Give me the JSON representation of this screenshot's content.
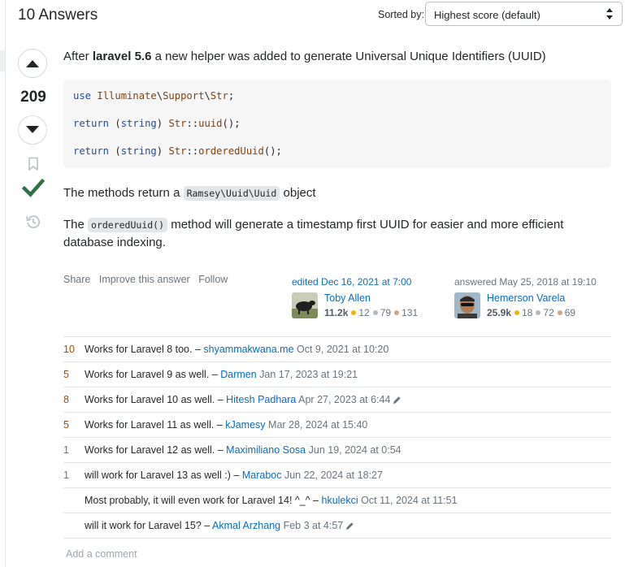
{
  "header": {
    "answers_count": "10 Answers",
    "sort_label": "Sorted by:",
    "sort_value": "Highest score (default)"
  },
  "voting": {
    "score": "209",
    "upvote_icon": "upvote-icon",
    "downvote_icon": "downvote-icon",
    "bookmark_icon": "bookmark-icon",
    "accepted_icon": "checkmark-icon",
    "history_icon": "history-icon",
    "accepted_color": "#2f6f44"
  },
  "post": {
    "intro_before": "After ",
    "intro_bold": "laravel 5.6",
    "intro_after": " a new helper was added to generate Universal Unique Identifiers (UUID)",
    "code": {
      "l1_kw": "use",
      "l1_ns1": "Illuminate",
      "l1_sep": "\\",
      "l1_ns2": "Support",
      "l1_ns3": "Str",
      "l1_end": ";",
      "l2_kw": "return",
      "l2_paren_open": "(",
      "l2_type": "string",
      "l2_paren_close": ")",
      "l2_cls": "Str",
      "l2_op": "::",
      "l2_fn": "uuid",
      "l2_end": "();",
      "l3_kw": "return",
      "l3_paren_open": "(",
      "l3_type": "string",
      "l3_paren_close": ")",
      "l3_cls": "Str",
      "l3_op": "::",
      "l3_fn": "orderedUuid",
      "l3_end": "();"
    },
    "p2_before": "The methods return a ",
    "p2_code": "Ramsey\\Uuid\\Uuid",
    "p2_after": " object",
    "p3_before": "The ",
    "p3_code": "orderedUuid()",
    "p3_after": " method will generate a timestamp first UUID for easier and more efficient database indexing."
  },
  "post_menu": {
    "share": "Share",
    "improve": "Improve this answer",
    "follow": "Follow"
  },
  "editor": {
    "action": "edited Dec 16, 2021 at 7:00",
    "name": "Toby Allen",
    "rep": "11.2k",
    "gold": "12",
    "silver": "79",
    "bronze": "131"
  },
  "author": {
    "action": "answered",
    "date": "May 25, 2018 at 19:10",
    "name": "Hemerson Varela",
    "rep": "25.9k",
    "gold": "18",
    "silver": "72",
    "bronze": "69"
  },
  "comments": [
    {
      "score": "10",
      "text": "Works for Laravel 8 too. –",
      "user": "shyammakwana.me",
      "date": "Oct 9, 2021 at 10:20"
    },
    {
      "score": "5",
      "text": "Works for Laravel 9 as well. –",
      "user": "Darmen",
      "date": "Jan 17, 2023 at 19:21"
    },
    {
      "score": "8",
      "text": "Works for Laravel 10 as well. –",
      "user": "Hitesh Padhara",
      "date": "Apr 27, 2023 at 6:44"
    },
    {
      "score": "5",
      "text": "Works for Laravel 11 as well. –",
      "user": "kJamesy",
      "date": "Mar 28, 2024 at 15:40"
    },
    {
      "score": "1",
      "text": "Works for Laravel 12 as well. –",
      "user": "Maximiliano Sosa",
      "date": "Jun 19, 2024 at 0:54"
    },
    {
      "score": "1",
      "text": "will work for Laravel 13 as well :) –",
      "user": "Maraboc",
      "date": "Jun 22, 2024 at 18:27"
    },
    {
      "score": "",
      "text": "Most probably, it will even work for Laravel 14! ^_^ –",
      "user": "hkulekci",
      "date": "Oct 11, 2024 at 11:51"
    },
    {
      "score": "",
      "text": "will it work for Laravel 15? –",
      "user": "Akmal Arzhang",
      "date": "Feb 3 at 4:57"
    }
  ],
  "add_comment": "Add a comment"
}
